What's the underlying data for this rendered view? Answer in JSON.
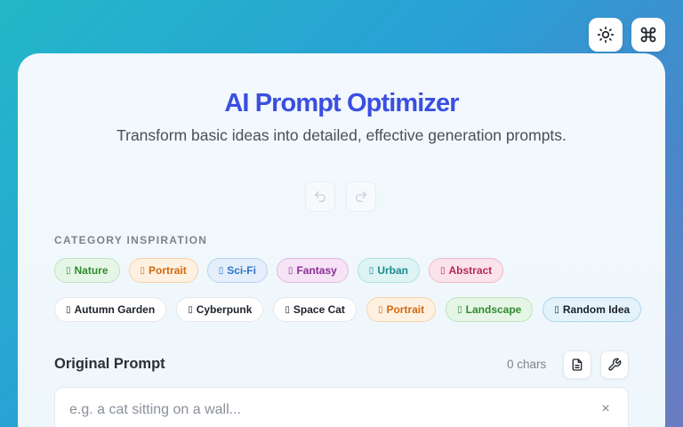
{
  "header": {
    "title": "AI Prompt Optimizer",
    "subtitle": "Transform basic ideas into detailed, effective generation prompts."
  },
  "top_bar": [
    {
      "name": "theme-toggle-button",
      "icon": "sun-icon"
    },
    {
      "name": "command-palette-button",
      "icon": "command-icon"
    }
  ],
  "history": {
    "undo_icon": "undo-icon",
    "redo_icon": "redo-icon"
  },
  "categories": {
    "label": "CATEGORY INSPIRATION",
    "chips": [
      {
        "label": "Nature",
        "icon": "leaf-icon",
        "bg": "#e6f6e6",
        "border": "#bfe3bf",
        "color": "#2e8b2e"
      },
      {
        "label": "Portrait",
        "icon": "person-icon",
        "bg": "#fff1e1",
        "border": "#f7d3a9",
        "color": "#d2690e"
      },
      {
        "label": "Sci-Fi",
        "icon": "rocket-icon",
        "bg": "#e4effb",
        "border": "#b9d4f0",
        "color": "#2c74c9"
      },
      {
        "label": "Fantasy",
        "icon": "castle-icon",
        "bg": "#f6e4f6",
        "border": "#e3b9e3",
        "color": "#8a2d94"
      },
      {
        "label": "Urban",
        "icon": "city-icon",
        "bg": "#def4f4",
        "border": "#b1e1e1",
        "color": "#1c8a8f"
      },
      {
        "label": "Abstract",
        "icon": "palette-icon",
        "bg": "#fbe3ec",
        "border": "#f0b8cb",
        "color": "#b52a56"
      }
    ]
  },
  "suggestions": [
    {
      "label": "Autumn Garden",
      "icon": "leaf-icon",
      "style": "plain"
    },
    {
      "label": "Cyberpunk",
      "icon": "robot-icon",
      "style": "plain"
    },
    {
      "label": "Space Cat",
      "icon": "cat-icon",
      "style": "plain"
    },
    {
      "label": "Portrait",
      "icon": "person-icon",
      "style": "tinted",
      "bg": "#fff1e1",
      "border": "#f7d3a9",
      "color": "#d2690e"
    },
    {
      "label": "Landscape",
      "icon": "mountain-icon",
      "style": "tinted",
      "bg": "#e6f6e6",
      "border": "#bfe3bf",
      "color": "#2e8b2e"
    },
    {
      "label": "Random Idea",
      "icon": "dice-icon",
      "style": "tinted",
      "bg": "#e3f2fb",
      "border": "#a9d6ef",
      "color": "#1d222a"
    }
  ],
  "prompt": {
    "label": "Original Prompt",
    "char_count": "0 chars",
    "placeholder": "e.g. a cat sitting on a wall...",
    "value": "",
    "clear_glyph": "×",
    "tools": [
      {
        "name": "template-button",
        "icon": "document-icon"
      },
      {
        "name": "tools-button",
        "icon": "wrench-icon"
      }
    ]
  },
  "colors": {
    "accent": "#3a4fe0",
    "chip_icon_placeholder": "▯"
  }
}
